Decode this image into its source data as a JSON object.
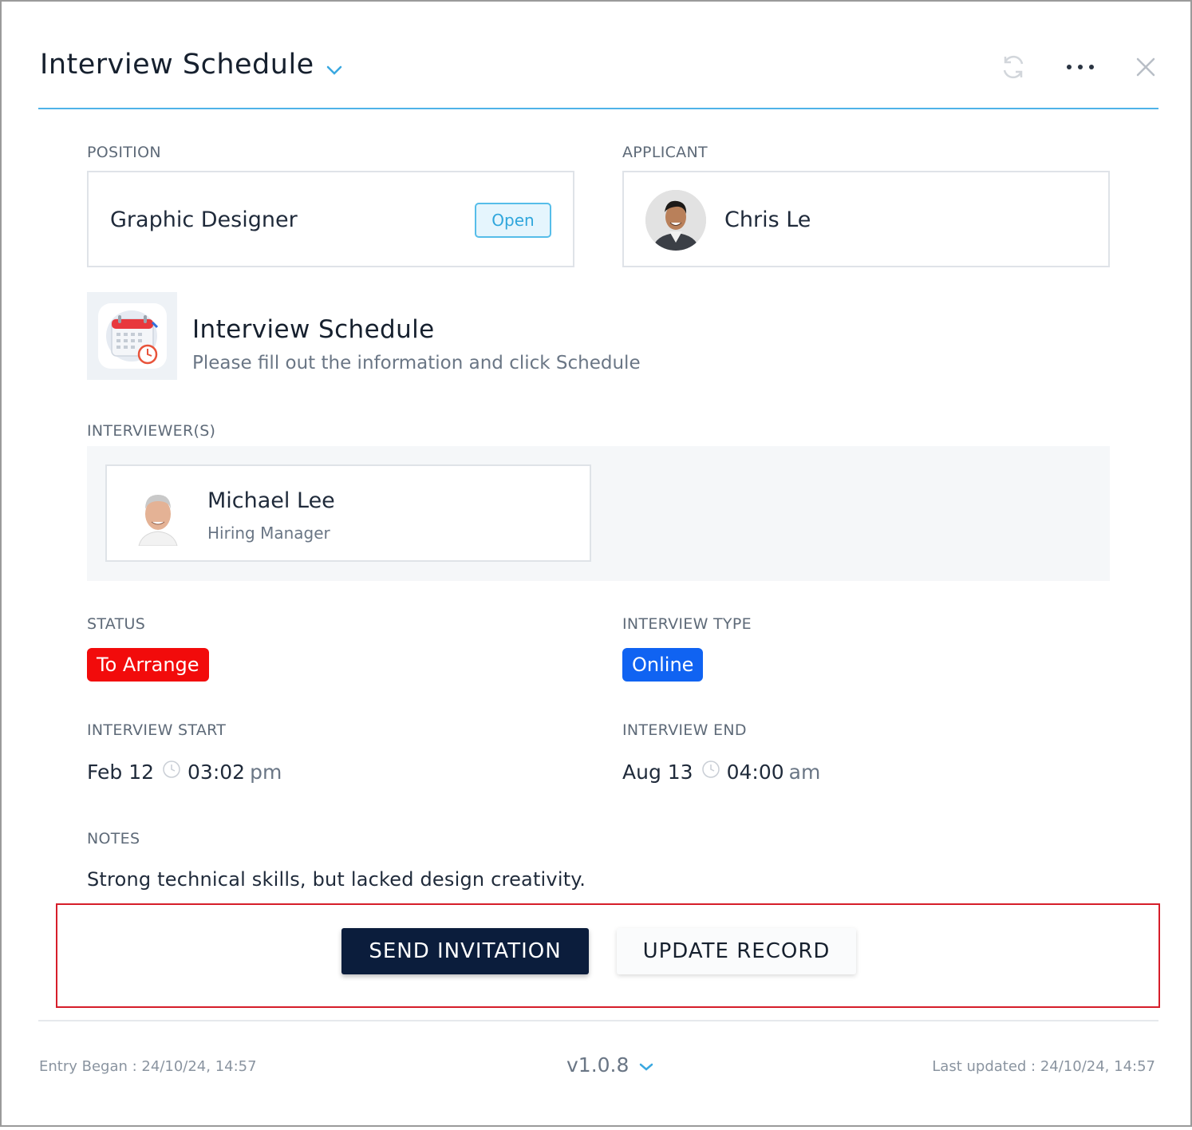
{
  "header": {
    "title": "Interview Schedule",
    "icons": [
      "chevron-down-icon",
      "refresh-icon",
      "more-icon",
      "close-icon"
    ],
    "accent": "#4fb3e8"
  },
  "position": {
    "label": "POSITION",
    "name": "Graphic Designer",
    "badge": "Open"
  },
  "applicant": {
    "label": "APPLICANT",
    "name": "Chris Le"
  },
  "schedule": {
    "title": "Interview Schedule",
    "subtitle": "Please fill out the information and click Schedule",
    "icon": "calendar-icon"
  },
  "interviewers": {
    "label": "INTERVIEWER(S)",
    "items": [
      {
        "name": "Michael Lee",
        "role": "Hiring Manager"
      }
    ]
  },
  "status": {
    "label": "STATUS",
    "value": "To Arrange",
    "color": "#f20b0b"
  },
  "interview_type": {
    "label": "INTERVIEW TYPE",
    "value": "Online",
    "color": "#1063f2"
  },
  "interview_start": {
    "label": "INTERVIEW START",
    "date": "Feb 12",
    "time": "03:02",
    "ampm": "pm"
  },
  "interview_end": {
    "label": "INTERVIEW END",
    "date": "Aug 13",
    "time": "04:00",
    "ampm": "am"
  },
  "notes": {
    "label": "NOTES",
    "text": "Strong technical skills, but lacked design creativity."
  },
  "actions": {
    "send": "SEND INVITATION",
    "update": "UPDATE RECORD"
  },
  "footer": {
    "entry_began": "Entry Began : 24/10/24, 14:57",
    "version": "v1.0.8",
    "last_updated": "Last updated : 24/10/24, 14:57"
  }
}
